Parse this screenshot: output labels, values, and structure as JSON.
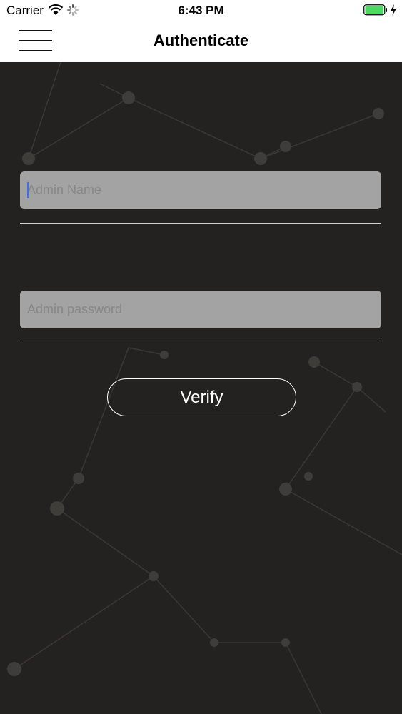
{
  "status_bar": {
    "carrier": "Carrier",
    "time": "6:43 PM",
    "wifi_icon": "wifi-icon",
    "activity_icon": "activity-spinner-icon",
    "battery_icon": "battery-full-icon",
    "charging_icon": "charging-bolt-icon",
    "battery_color": "#4cd964"
  },
  "nav_bar": {
    "title": "Authenticate",
    "menu_icon": "hamburger-menu-icon"
  },
  "form": {
    "admin_name": {
      "value": "",
      "placeholder": "Admin Name"
    },
    "admin_password": {
      "value": "",
      "placeholder": "Admin password"
    },
    "verify_label": "Verify"
  },
  "colors": {
    "background": "#242220",
    "field_background": "#a3a3a3",
    "caret": "#3b6ff0"
  }
}
